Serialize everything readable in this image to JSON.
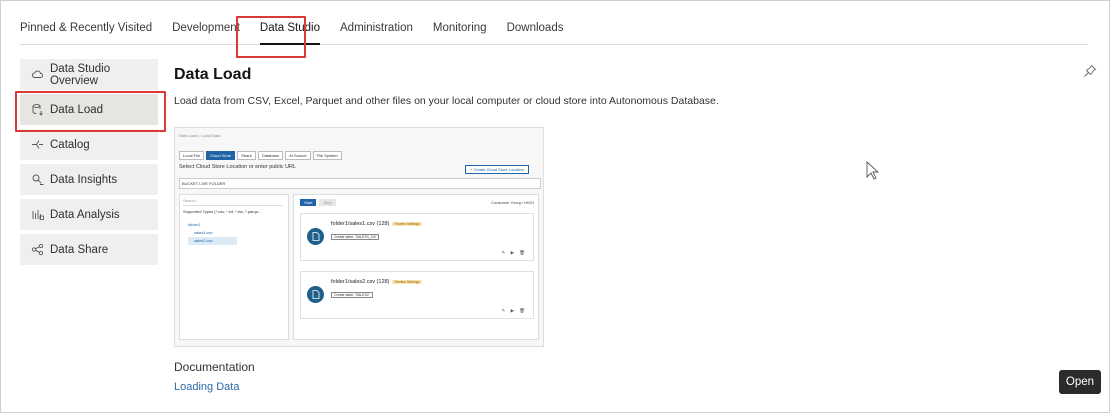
{
  "tabs": [
    {
      "label": "Pinned & Recently Visited"
    },
    {
      "label": "Development"
    },
    {
      "label": "Data Studio"
    },
    {
      "label": "Administration"
    },
    {
      "label": "Monitoring"
    },
    {
      "label": "Downloads"
    }
  ],
  "active_tab": "Data Studio",
  "sidebar": {
    "items": [
      {
        "label": "Data Studio Overview",
        "icon": "cloud-icon"
      },
      {
        "label": "Data Load",
        "icon": "database-load-icon"
      },
      {
        "label": "Catalog",
        "icon": "catalog-icon"
      },
      {
        "label": "Data Insights",
        "icon": "insights-icon"
      },
      {
        "label": "Data Analysis",
        "icon": "analysis-icon"
      },
      {
        "label": "Data Share",
        "icon": "share-icon"
      }
    ],
    "active": "Data Load"
  },
  "main": {
    "title": "Data Load",
    "description": "Load data from CSV, Excel, Parquet and other files on your local computer or cloud store into Autonomous Database.",
    "documentation_heading": "Documentation",
    "documentation_link": "Loading Data",
    "open_button": "Open"
  },
  "preview": {
    "breadcrumb": "Data Load > Load Data",
    "tabs": [
      "Local File",
      "Cloud Store",
      "Share",
      "Database",
      "AI Source",
      "File System"
    ],
    "select_label": "Select Cloud Store Location or enter public URL",
    "create_button": "+ Create Cloud Store Location",
    "bucket": "BUCKET LIVE FOLDER",
    "search_placeholder": "Search...",
    "supported_types": "Supported Types (*.csv, *.txt, *.tsv, *.parqu...",
    "tree": [
      "folder1",
      "sales1.csv",
      "sales2.csv"
    ],
    "start": "Start",
    "stop": "Stop",
    "consumer_group": "Consumer Group: HIGH",
    "cards": [
      {
        "name": "folder1/sales1.csv (128)",
        "badge": "Review Settings",
        "target": "Create table: 'SALES1_CB'"
      },
      {
        "name": "folder1/sales2.csv (128)",
        "badge": "Review Settings",
        "target": "Create table: 'SALES2'"
      }
    ]
  },
  "colors": {
    "highlight": "#d93a35",
    "link": "#2b6cab",
    "sidebar_bg": "#f1efed",
    "open_button": "#2b2b2b"
  }
}
